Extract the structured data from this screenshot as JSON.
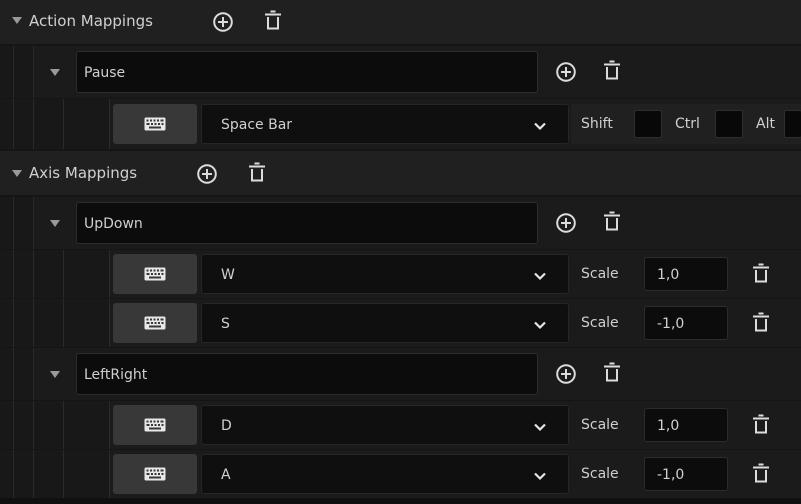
{
  "action_section": {
    "label": "Action Mappings"
  },
  "axis_section": {
    "label": "Axis Mappings"
  },
  "pause": {
    "name": "Pause",
    "key": "Space Bar",
    "mods": {
      "shift": "Shift",
      "ctrl": "Ctrl",
      "alt": "Alt"
    }
  },
  "updown": {
    "name": "UpDown",
    "rows": [
      {
        "key": "W",
        "scale_label": "Scale",
        "scale": "1,0"
      },
      {
        "key": "S",
        "scale_label": "Scale",
        "scale": "-1,0"
      }
    ]
  },
  "leftright": {
    "name": "LeftRight",
    "rows": [
      {
        "key": "D",
        "scale_label": "Scale",
        "scale": "1,0"
      },
      {
        "key": "A",
        "scale_label": "Scale",
        "scale": "-1,0"
      }
    ]
  },
  "icons": {
    "add": "plus-circle-icon",
    "delete": "trash-icon",
    "key": "keyboard-icon",
    "expand": "chevron-down-icon"
  }
}
